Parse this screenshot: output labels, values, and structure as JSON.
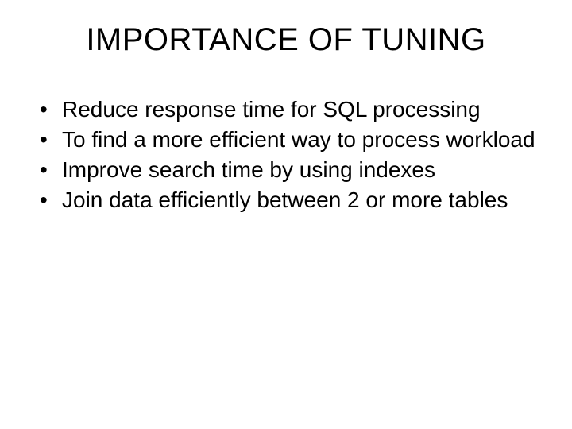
{
  "slide": {
    "title": "IMPORTANCE OF TUNING",
    "bullets": [
      "Reduce response time for SQL processing",
      "To find a more efficient way to process workload",
      "Improve search time by using indexes",
      "Join data efficiently between 2 or more tables"
    ]
  }
}
